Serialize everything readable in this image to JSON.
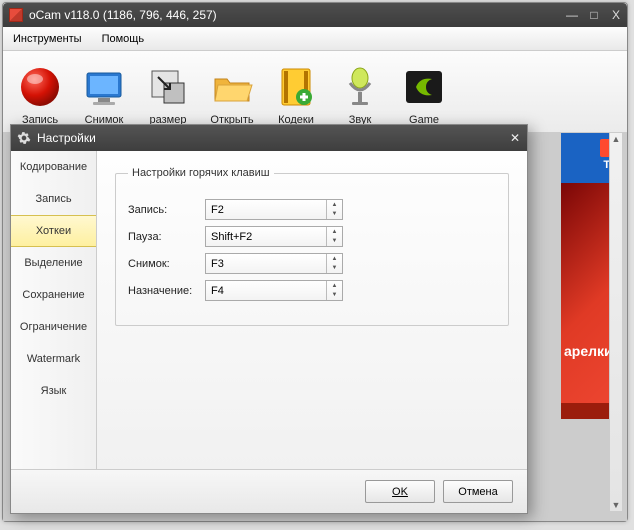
{
  "window": {
    "title": "oCam v118.0 (1186, 796, 446, 257)",
    "minimize": "—",
    "maximize": "□",
    "close": "X"
  },
  "menu": {
    "tools": "Инструменты",
    "help": "Помощь"
  },
  "toolbar": {
    "record": "Запись",
    "snapshot": "Снимок",
    "resize": "размер",
    "open": "Открыть",
    "codecs": "Кодеки",
    "sound": "Звук",
    "game": "Game"
  },
  "banner": {
    "tb_label": "ТВ",
    "ad_text": "арелки",
    "close_badge": "X"
  },
  "dialog": {
    "title": "Настройки",
    "tabs": {
      "encoding": "Кодирование",
      "record": "Запись",
      "hotkeys": "Хоткеи",
      "selection": "Выделение",
      "save": "Сохранение",
      "limit": "Ограничение",
      "watermark": "Watermark",
      "language": "Язык"
    },
    "pane": {
      "legend": "Настройки горячих клавиш",
      "record_label": "Запись:",
      "record_value": "F2",
      "pause_label": "Пауза:",
      "pause_value": "Shift+F2",
      "snapshot_label": "Снимок:",
      "snapshot_value": "F3",
      "target_label": "Назначение:",
      "target_value": "F4"
    },
    "buttons": {
      "ok": "OK",
      "cancel": "Отмена"
    }
  }
}
